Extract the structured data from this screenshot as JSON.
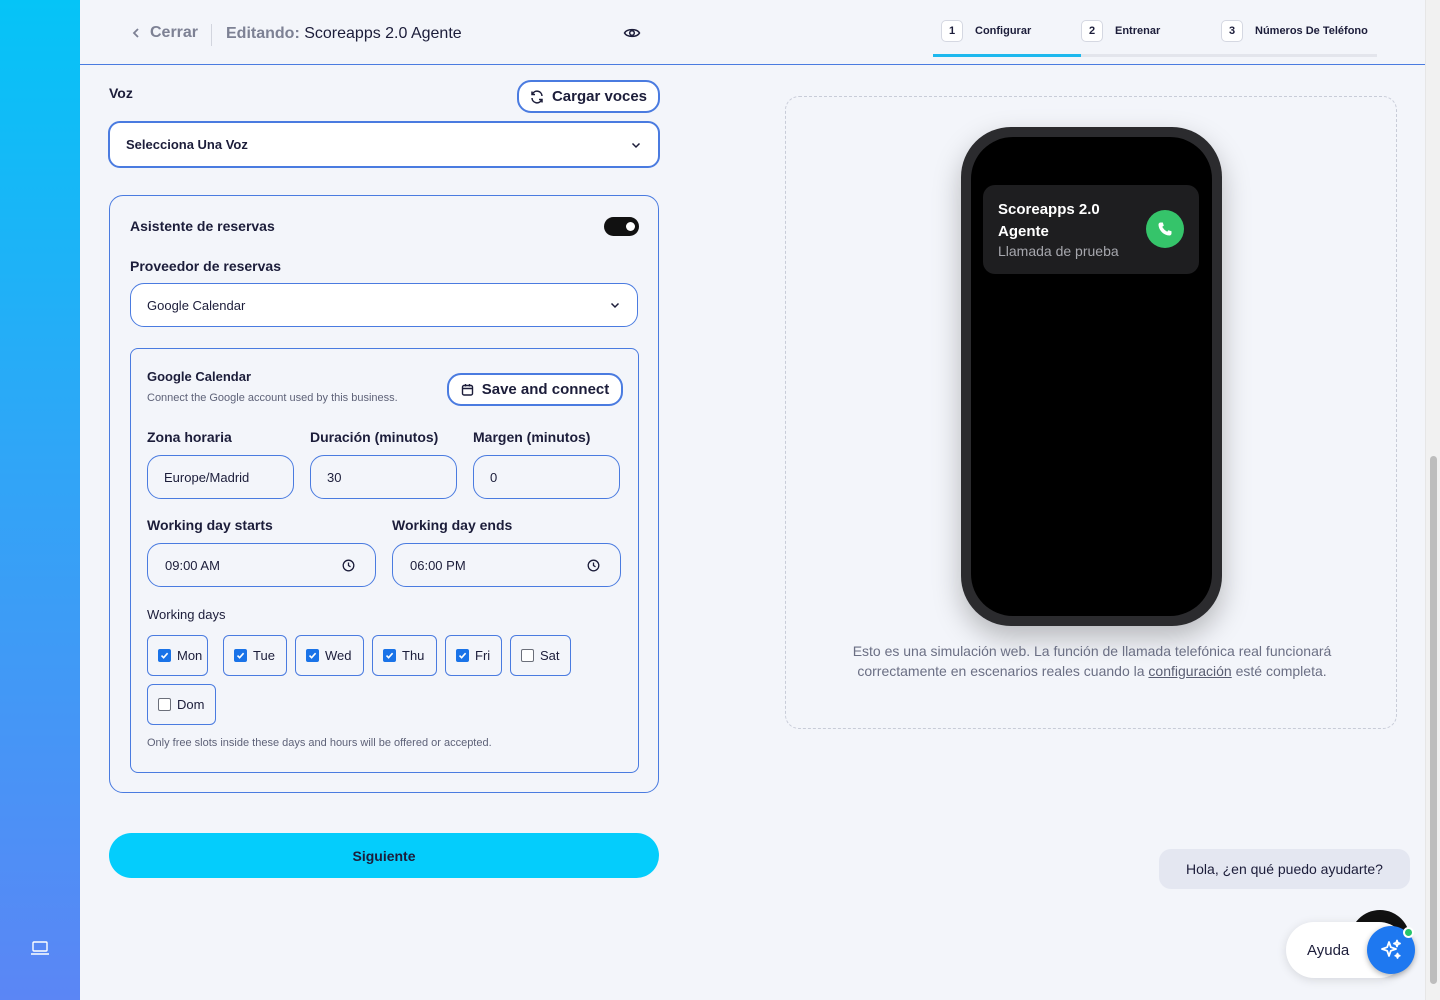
{
  "header": {
    "back_label": "Cerrar",
    "editing_prefix": "Editando:",
    "agent_name": "Scoreapps 2.0 Agente",
    "steps": [
      {
        "num": "1",
        "label": "Configurar"
      },
      {
        "num": "2",
        "label": "Entrenar"
      },
      {
        "num": "3",
        "label": "Números De Teléfono"
      }
    ],
    "progress_fraction": 0.333
  },
  "voice": {
    "label": "Voz",
    "load_button": "Cargar voces",
    "select_value": "Selecciona Una Voz"
  },
  "booking": {
    "title": "Asistente de reservas",
    "toggle_on": true,
    "provider_label": "Proveedor de reservas",
    "provider_value": "Google Calendar",
    "calendar": {
      "title": "Google Calendar",
      "description": "Connect the Google account used by this business.",
      "connect_button": "Save and connect",
      "timezone_label": "Zona horaria",
      "timezone_value": "Europe/Madrid",
      "duration_label": "Duración (minutos)",
      "duration_value": "30",
      "margin_label": "Margen (minutos)",
      "margin_value": "0",
      "start_label": "Working day starts",
      "start_value": "09:00 AM",
      "end_label": "Working day ends",
      "end_value": "06:00 PM",
      "days_label": "Working days",
      "days": [
        {
          "label": "Mon",
          "checked": true
        },
        {
          "label": "Tue",
          "checked": true
        },
        {
          "label": "Wed",
          "checked": true
        },
        {
          "label": "Thu",
          "checked": true
        },
        {
          "label": "Fri",
          "checked": true
        },
        {
          "label": "Sat",
          "checked": false
        },
        {
          "label": "Dom",
          "checked": false
        }
      ],
      "hint": "Only free slots inside these days and hours will be offered or accepted."
    }
  },
  "next_button": "Siguiente",
  "preview": {
    "call_name": "Scoreapps 2.0 Agente",
    "call_subtitle": "Llamada de prueba",
    "note_before": "Esto es una simulación web. La función de llamada telefónica real funcionará correctamente en escenarios reales cuando la ",
    "note_link": "configuración",
    "note_after": " esté completa."
  },
  "chat": {
    "greeting": "Hola, ¿en qué puedo ayudarte?",
    "help_label": "Ayuda"
  },
  "colors": {
    "accent": "#04cdfc",
    "border_blue": "#4a7be0",
    "checkbox": "#1a73e8",
    "call_green": "#35c46a"
  },
  "icons": [
    "chevron-left-icon",
    "eye-icon",
    "refresh-icon",
    "chevron-down-icon",
    "calendar-icon",
    "clock-icon",
    "phone-icon",
    "sparkle-icon",
    "laptop-icon"
  ]
}
